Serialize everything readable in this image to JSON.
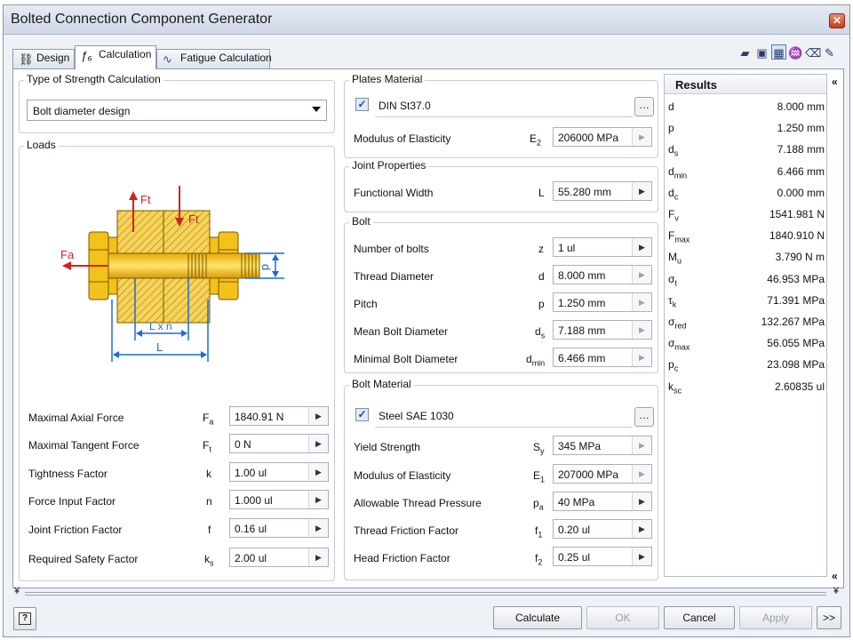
{
  "window": {
    "title": "Bolted Connection Component Generator"
  },
  "tabs": [
    {
      "label": "Design",
      "icon": "bolt-design-icon"
    },
    {
      "label": "Calculation",
      "icon": "function-icon"
    },
    {
      "label": "Fatigue Calculation",
      "icon": "fatigue-chart-icon"
    }
  ],
  "strength": {
    "group_label": "Type of Strength Calculation",
    "selected": "Bolt diameter design"
  },
  "loads": {
    "group_label": "Loads",
    "diagram": {
      "fa": "Fa",
      "ft": "Ft",
      "d": "d",
      "lxn": "L x n",
      "l": "L"
    },
    "rows": [
      {
        "label": "Maximal Axial Force",
        "sym": "F",
        "sub": "a",
        "value": "1840.91 N"
      },
      {
        "label": "Maximal Tangent Force",
        "sym": "F",
        "sub": "t",
        "value": "0 N"
      },
      {
        "label": "Tightness Factor",
        "sym": "k",
        "sub": "",
        "value": "1.00 ul"
      },
      {
        "label": "Force Input Factor",
        "sym": "n",
        "sub": "",
        "value": "1.000 ul"
      },
      {
        "label": "Joint Friction Factor",
        "sym": "f",
        "sub": "",
        "value": "0.16 ul"
      },
      {
        "label": "Required Safety Factor",
        "sym": "k",
        "sub": "s",
        "value": "2.00 ul"
      }
    ]
  },
  "plates": {
    "group_label": "Plates Material",
    "material": "DIN St37.0",
    "checked": "✓",
    "modulus": {
      "label": "Modulus of Elasticity",
      "sym": "E",
      "sub": "2",
      "value": "206000 MPa"
    }
  },
  "joint": {
    "group_label": "Joint Properties",
    "width": {
      "label": "Functional Width",
      "sym": "L",
      "sub": "",
      "value": "55.280 mm"
    }
  },
  "bolt": {
    "group_label": "Bolt",
    "rows": [
      {
        "label": "Number of bolts",
        "sym": "z",
        "sub": "",
        "value": "1 ul"
      },
      {
        "label": "Thread Diameter",
        "sym": "d",
        "sub": "",
        "value": "8.000 mm"
      },
      {
        "label": "Pitch",
        "sym": "p",
        "sub": "",
        "value": "1.250 mm"
      },
      {
        "label": "Mean Bolt Diameter",
        "sym": "d",
        "sub": "s",
        "value": "7.188 mm"
      },
      {
        "label": "Minimal Bolt Diameter",
        "sym": "d",
        "sub": "min",
        "value": "6.466 mm"
      }
    ]
  },
  "bolt_material": {
    "group_label": "Bolt Material",
    "material": "Steel SAE 1030",
    "checked": "✓",
    "rows": [
      {
        "label": "Yield Strength",
        "sym": "S",
        "sub": "y",
        "value": "345 MPa"
      },
      {
        "label": "Modulus of Elasticity",
        "sym": "E",
        "sub": "1",
        "value": "207000 MPa"
      },
      {
        "label": "Allowable Thread Pressure",
        "sym": "p",
        "sub": "a",
        "value": "40 MPa"
      },
      {
        "label": "Thread Friction Factor",
        "sym": "f",
        "sub": "1",
        "value": "0.20 ul"
      },
      {
        "label": "Head Friction Factor",
        "sym": "f",
        "sub": "2",
        "value": "0.25 ul"
      }
    ]
  },
  "results": {
    "header": "Results",
    "rows": [
      {
        "sym": "d",
        "sub": "",
        "value": "8.000 mm"
      },
      {
        "sym": "p",
        "sub": "",
        "value": "1.250 mm"
      },
      {
        "sym": "d",
        "sub": "s",
        "value": "7.188 mm"
      },
      {
        "sym": "d",
        "sub": "min",
        "value": "6.466 mm"
      },
      {
        "sym": "d",
        "sub": "c",
        "value": "0.000 mm"
      },
      {
        "sym": "F",
        "sub": "v",
        "value": "1541.981 N"
      },
      {
        "sym": "F",
        "sub": "max",
        "value": "1840.910 N"
      },
      {
        "sym": "M",
        "sub": "u",
        "value": "3.790 N m"
      },
      {
        "sym": "σ",
        "sub": "t",
        "value": "46.953 MPa"
      },
      {
        "sym": "τ",
        "sub": "k",
        "value": "71.391 MPa"
      },
      {
        "sym": "σ",
        "sub": "red",
        "value": "132.267 MPa"
      },
      {
        "sym": "σ",
        "sub": "max",
        "value": "56.055 MPa"
      },
      {
        "sym": "p",
        "sub": "c",
        "value": "23.098 MPa"
      },
      {
        "sym": "k",
        "sub": "sc",
        "value": "2.60835 ul"
      }
    ]
  },
  "toolbar_icons": [
    "open-icon",
    "save-icon",
    "calc-options-icon",
    "fatigue-icon",
    "eraser-icon",
    "notes-icon"
  ],
  "buttons": {
    "help": "?",
    "calculate": "Calculate",
    "ok": "OK",
    "cancel": "Cancel",
    "apply": "Apply",
    "more": ">>"
  },
  "colors": {
    "accent": "#1c4c9c",
    "bolt_yellow": "#f2c21a",
    "dimension_blue": "#1a6ad8",
    "force_red": "#d62020",
    "hatch": "#b48a10"
  }
}
